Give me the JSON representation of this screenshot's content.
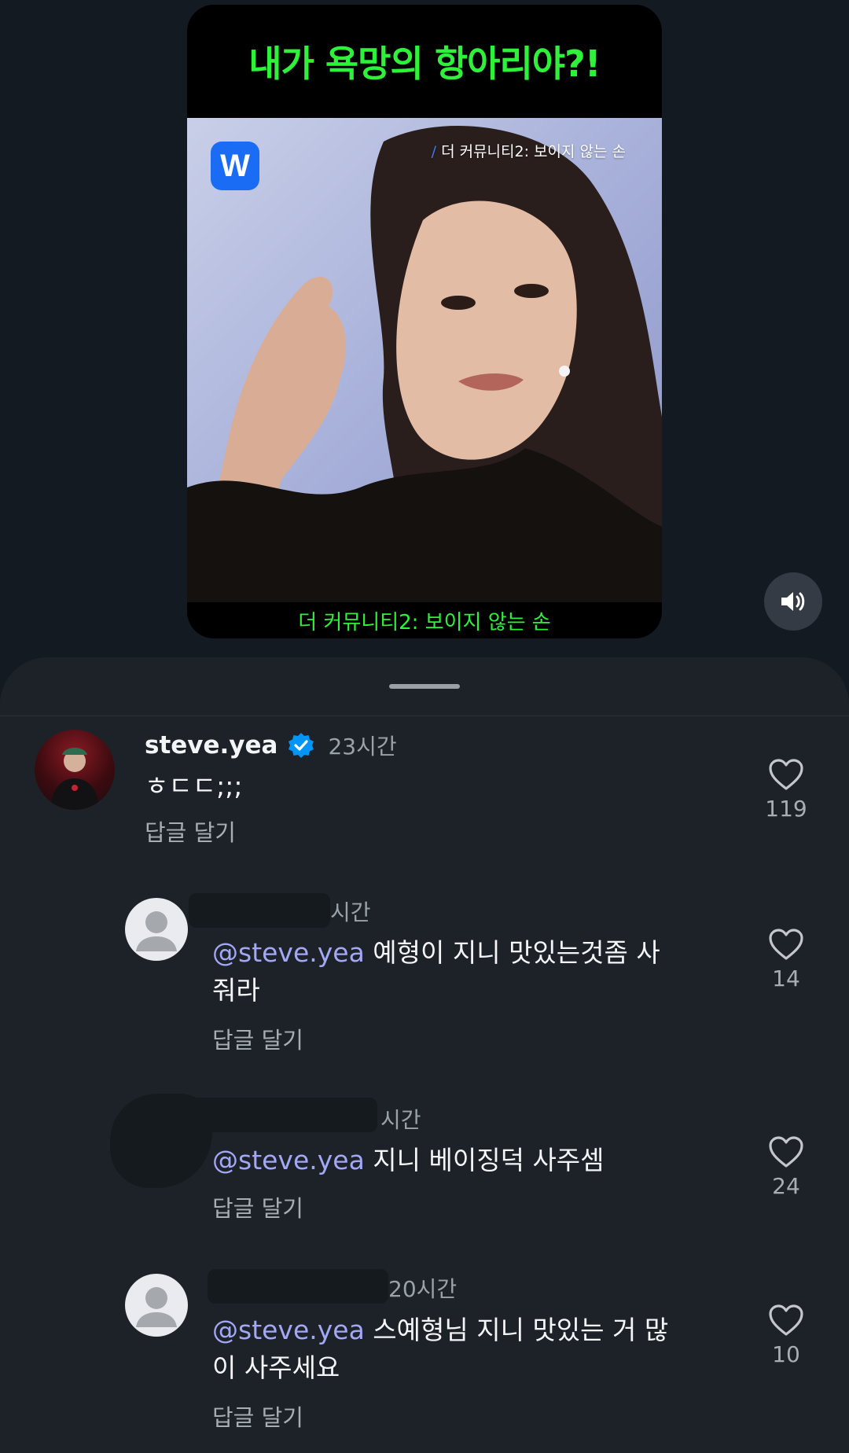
{
  "video": {
    "top_caption": "내가 욕망의 항아리야?!",
    "brand_logo": "W",
    "overlay_slash": "/",
    "overlay_title": "더 커뮤니티2: 보이지 않는 손",
    "bottom_caption": "더 커뮤니티2: 보이지 않는 손",
    "mute_icon": "speaker-icon"
  },
  "comments": [
    {
      "username": "steve.yea",
      "verified": true,
      "time": "23시간",
      "mention": "",
      "text": "ㅎㄷㄷ;;;",
      "reply_label": "답글 달기",
      "likes": "119"
    },
    {
      "username": "",
      "time": "시간",
      "mention": "@steve.yea",
      "text": " 예형이 지니 맛있는것좀 사줘라",
      "reply_label": "답글 달기",
      "likes": "14"
    },
    {
      "username": "",
      "time": "시간",
      "mention": "@steve.yea",
      "text": " 지니 베이징덕 사주셈",
      "reply_label": "답글 달기",
      "likes": "24"
    },
    {
      "username": "",
      "time": "20시간",
      "mention": "@steve.yea",
      "text": " 스예형님 지니 맛있는 거 많이 사주세요",
      "reply_label": "답글 달기",
      "likes": "10"
    }
  ],
  "colors": {
    "background": "#141a21",
    "sheet": "#1d2229",
    "caption_green": "#2ef13a",
    "mention": "#a3a8f5",
    "verified_blue": "#0095f6"
  }
}
